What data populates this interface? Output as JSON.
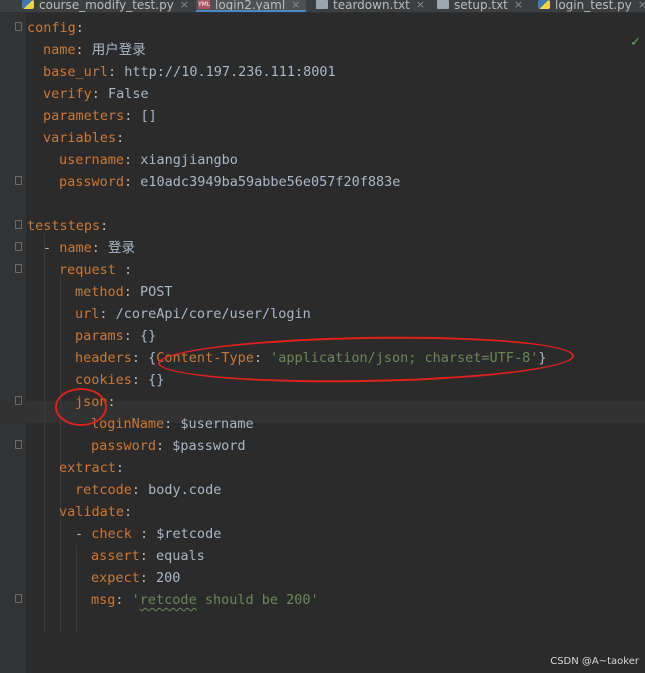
{
  "tabs": [
    {
      "label": "course_modify_test.py",
      "icon": "python-file-icon"
    },
    {
      "label": "login2.yaml",
      "icon": "yaml-file-icon"
    },
    {
      "label": "teardown.txt",
      "icon": "text-file-icon"
    },
    {
      "label": "setup.txt",
      "icon": "text-file-icon"
    },
    {
      "label": "login_test.py",
      "icon": "python-file-icon"
    }
  ],
  "yml_badge": "YML",
  "editor": {
    "line01_key": "config",
    "line02_key": "name",
    "line02_val": "用户登录",
    "line03_key": "base_url",
    "line03_val": "http://10.197.236.111:8001",
    "line04_key": "verify",
    "line04_val": "False",
    "line05_key": "parameters",
    "line05_val": "[]",
    "line06_key": "variables",
    "line07_key": "username",
    "line07_val": "xiangjiangbo",
    "line08_key": "password",
    "line08_val": "e10adc3949ba59abbe56e057f20f883e",
    "line10_key": "teststeps",
    "line11_key": "name",
    "line11_val": "登录",
    "line12_key": "request",
    "line13_key": "method",
    "line13_val": "POST",
    "line14_key": "url",
    "line14_val": "/coreApi/core/user/login",
    "line15_key": "params",
    "line15_val": "{}",
    "line16_key": "headers",
    "line16_hkey": "Content-Type",
    "line16_hval": "'application/json; charset=UTF-8'",
    "line17_key": "cookies",
    "line17_val": "{}",
    "line18_key": "json",
    "line19_key": "loginName",
    "line19_val": "$username",
    "line20_key": "password",
    "line20_val": "$password",
    "line21_key": "extract",
    "line22_key": "retcode",
    "line22_val": "body.code",
    "line23_key": "validate",
    "line24_key": "check",
    "line24_val": "$retcode",
    "line25_key": "assert",
    "line25_val": "equals",
    "line26_key": "expect",
    "line26_val": "200",
    "line27_key": "msg",
    "line27_val_open": "'",
    "line27_val_squiggle": "retcode",
    "line27_val_rest": " should be 200'"
  },
  "watermark": "CSDN @A~taoker",
  "colors": {
    "key": "#cc7832",
    "value": "#a9b7c6",
    "string": "#6a8759",
    "annotation": "#e0211b",
    "background": "#2b2b2b"
  }
}
